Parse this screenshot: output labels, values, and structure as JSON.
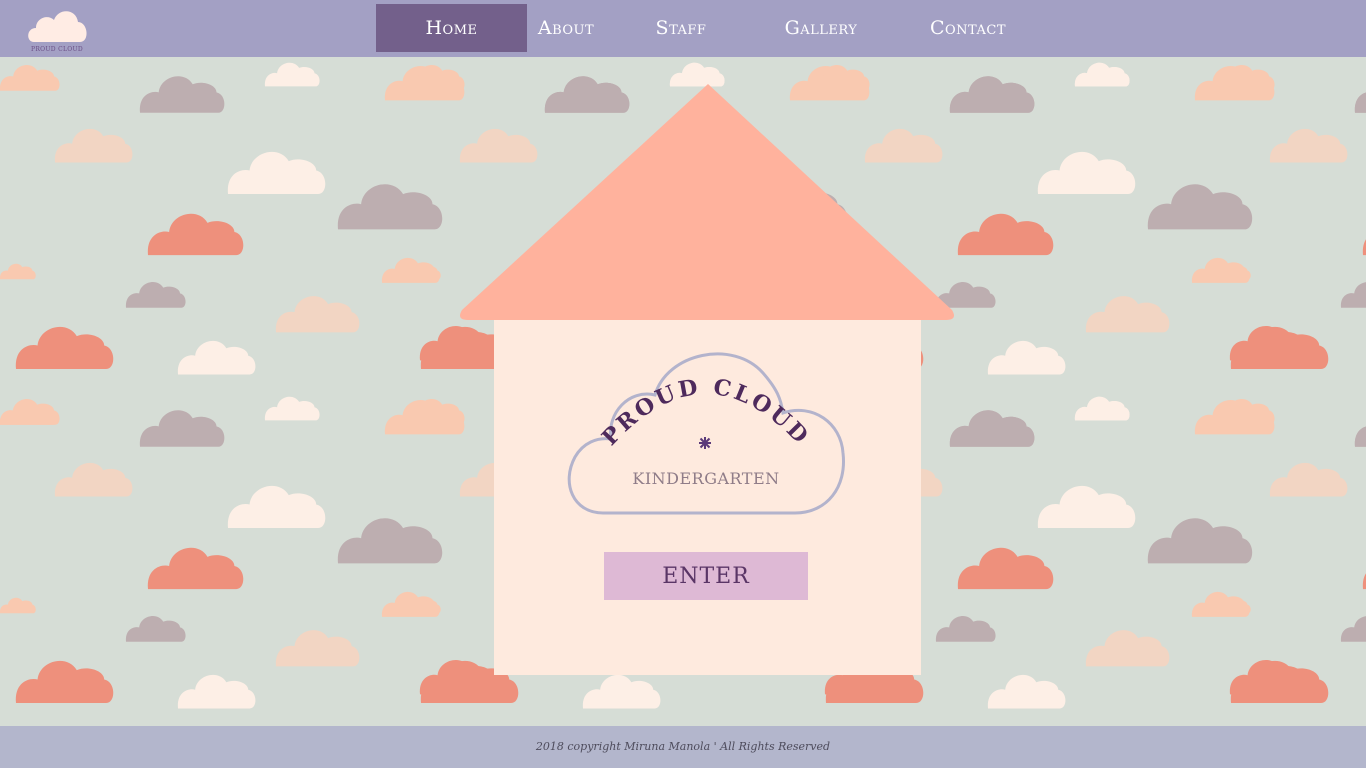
{
  "brand": {
    "logo_text": "PROUD CLOUD"
  },
  "nav": {
    "items": [
      {
        "label": "Home",
        "active": true
      },
      {
        "label": "About",
        "active": false
      },
      {
        "label": "Staff",
        "active": false
      },
      {
        "label": "Gallery",
        "active": false
      },
      {
        "label": "Contact",
        "active": false
      }
    ]
  },
  "hero": {
    "emblem_title": "PROUD CLOUD",
    "emblem_subtitle": "KINDERGARTEN",
    "enter_label": "ENTER"
  },
  "footer": {
    "copyright": "2018 copyright Miruna Manola ' All Rights Reserved"
  },
  "colors": {
    "header_bg": "#a3a0c4",
    "nav_active_bg": "#73608b",
    "page_bg": "#d6ddd6",
    "roof": "#ffb29d",
    "house": "#feeade",
    "enter_bg": "#deb9d5",
    "footer_bg": "#b3b6cc"
  }
}
